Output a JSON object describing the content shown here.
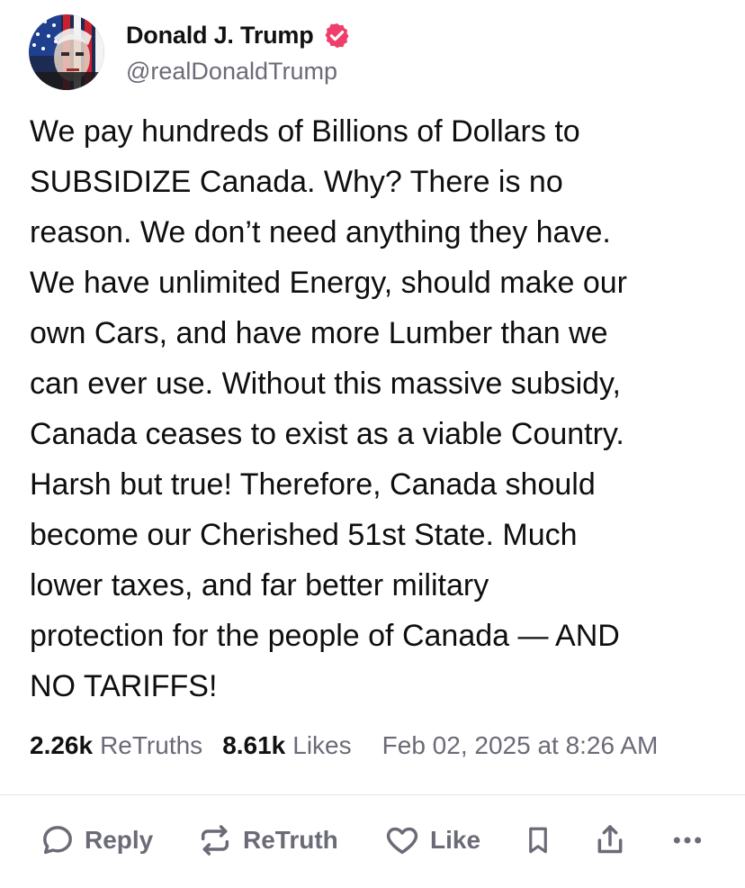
{
  "author": {
    "display_name": "Donald J. Trump",
    "handle": "@realDonaldTrump",
    "verified": true,
    "verified_color": "#ef3e6b"
  },
  "post": {
    "text": "We pay hundreds of Billions of Dollars to\nSUBSIDIZE Canada. Why? There is no\nreason. We don’t need anything they have.\nWe have unlimited Energy, should make our\nown Cars, and have more Lumber than we\ncan ever use. Without this massive subsidy,\nCanada ceases to exist as a viable Country.\nHarsh but true! Therefore, Canada should\nbecome our Cherished 51st State. Much\nlower taxes, and far better military\nprotection for the people of Canada — AND\nNO TARIFFS!"
  },
  "stats": {
    "retruths_count": "2.26k",
    "retruths_label": "ReTruths",
    "likes_count": "8.61k",
    "likes_label": "Likes",
    "date": "Feb 02, 2025 at 8:26 AM"
  },
  "actions": {
    "reply_label": "Reply",
    "retruth_label": "ReTruth",
    "like_label": "Like",
    "icons": [
      "speech-bubble-icon",
      "retruth-arrows-icon",
      "heart-icon",
      "bookmark-icon",
      "share-icon",
      "more-icon"
    ]
  },
  "colors": {
    "text": "#0f0f0f",
    "muted": "#6b6b78",
    "divider": "#e6e6ea"
  }
}
